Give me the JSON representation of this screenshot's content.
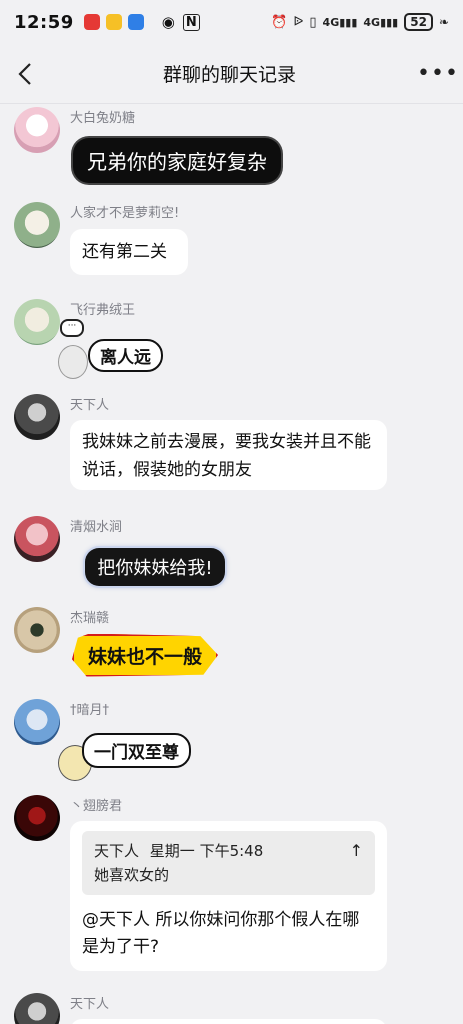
{
  "status_bar": {
    "time": "12:59",
    "battery": "52"
  },
  "nav": {
    "title": "群聊的聊天记录"
  },
  "messages": [
    {
      "name": "大白兔奶糖",
      "text": "兄弟你的家庭好复杂"
    },
    {
      "name": "人家才不是萝莉空!",
      "text": "还有第二关"
    },
    {
      "name": "飞行弗绒王",
      "text": "离人远"
    },
    {
      "name": "天下人",
      "text": "我妹妹之前去漫展，要我女装并且不能说话，假装她的女朋友"
    },
    {
      "name": "清烟水涧",
      "text": "把你妹妹给我!"
    },
    {
      "name": "杰瑞赣",
      "text": "妹妹也不一般"
    },
    {
      "name": "†暗月†",
      "text": "一门双至尊"
    },
    {
      "name": "丶翅膀君",
      "quote": {
        "author": "天下人",
        "time": "星期一 下午5:48",
        "text": "她喜欢女的"
      },
      "text": "@天下人 所以你妹问你那个假人在哪是为了干?"
    },
    {
      "name": "天下人"
    }
  ]
}
